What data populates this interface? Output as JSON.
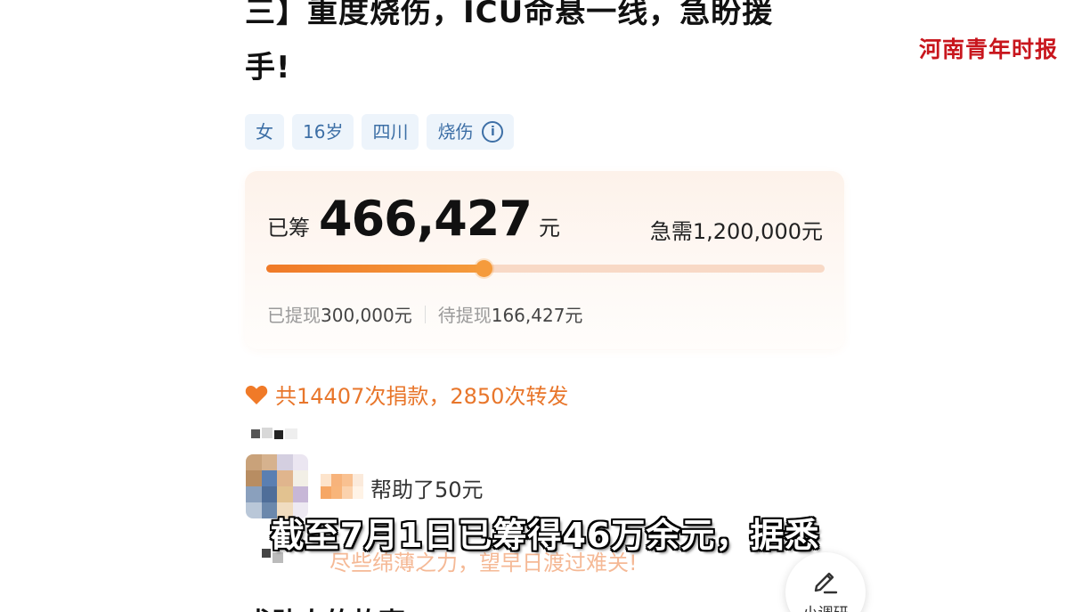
{
  "header": {
    "title_line1": "三】重度烧伤，ICU命悬一线，急盼援",
    "title_line2": "手!"
  },
  "watermark": "河南青年时报",
  "tags": [
    "女",
    "16岁",
    "四川",
    "烧伤"
  ],
  "fundraising": {
    "raised_label": "已筹",
    "raised_value": "466,427",
    "raised_unit": "元",
    "target_text": "急需1,200,000元",
    "progress_fraction": 0.3887,
    "withdrawn_label": "已提现",
    "withdrawn_value": "300,000元",
    "pending_label": "待提现",
    "pending_value": "166,427元"
  },
  "stats": {
    "text": "共14407次捐款，2850次转发"
  },
  "donation": {
    "text": "帮助了50元",
    "message": "尽些绵薄之力，望早日渡过难关!"
  },
  "subtitle": "截至7月1日已筹得46万余元，据悉",
  "fab": {
    "label": "小调研",
    "icon": "pencil-icon"
  },
  "section_head": "求助人的故事",
  "colors": {
    "accent_orange": "#e8762b",
    "tag_blue": "#3d6fa6",
    "tag_bg": "#edf4fb",
    "watermark_red": "#c8161d"
  }
}
